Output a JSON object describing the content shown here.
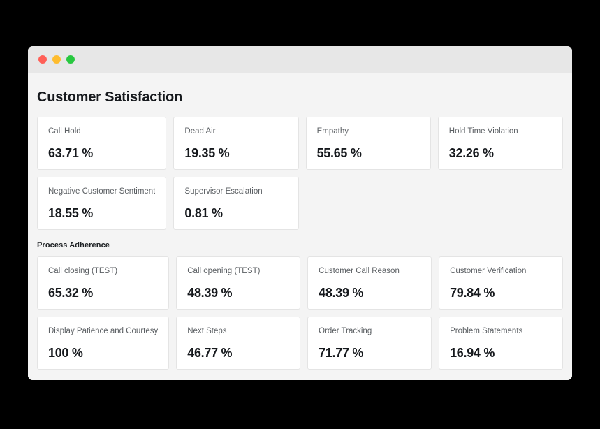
{
  "window": {
    "traffic_lights": [
      {
        "name": "close",
        "color": "#ff5f57"
      },
      {
        "name": "minimize",
        "color": "#febc2e"
      },
      {
        "name": "maximize",
        "color": "#28c840"
      }
    ]
  },
  "page": {
    "title": "Customer Satisfaction"
  },
  "sections": [
    {
      "label": null,
      "cards": [
        {
          "label": "Call Hold",
          "value": "63.71 %"
        },
        {
          "label": "Dead Air",
          "value": "19.35 %"
        },
        {
          "label": "Empathy",
          "value": "55.65 %"
        },
        {
          "label": "Hold Time Violation",
          "value": "32.26 %"
        },
        {
          "label": "Negative Customer Sentiment",
          "value": "18.55 %"
        },
        {
          "label": "Supervisor Escalation",
          "value": "0.81 %"
        }
      ]
    },
    {
      "label": "Process Adherence",
      "cards": [
        {
          "label": "Call closing (TEST)",
          "value": "65.32 %"
        },
        {
          "label": "Call opening (TEST)",
          "value": "48.39 %"
        },
        {
          "label": "Customer Call Reason",
          "value": "48.39 %"
        },
        {
          "label": "Customer Verification",
          "value": "79.84 %"
        },
        {
          "label": "Display Patience and Courtesy",
          "value": "100 %"
        },
        {
          "label": "Next Steps",
          "value": "46.77 %"
        },
        {
          "label": "Order Tracking",
          "value": "71.77 %"
        },
        {
          "label": "Problem Statements",
          "value": "16.94 %"
        }
      ]
    }
  ]
}
